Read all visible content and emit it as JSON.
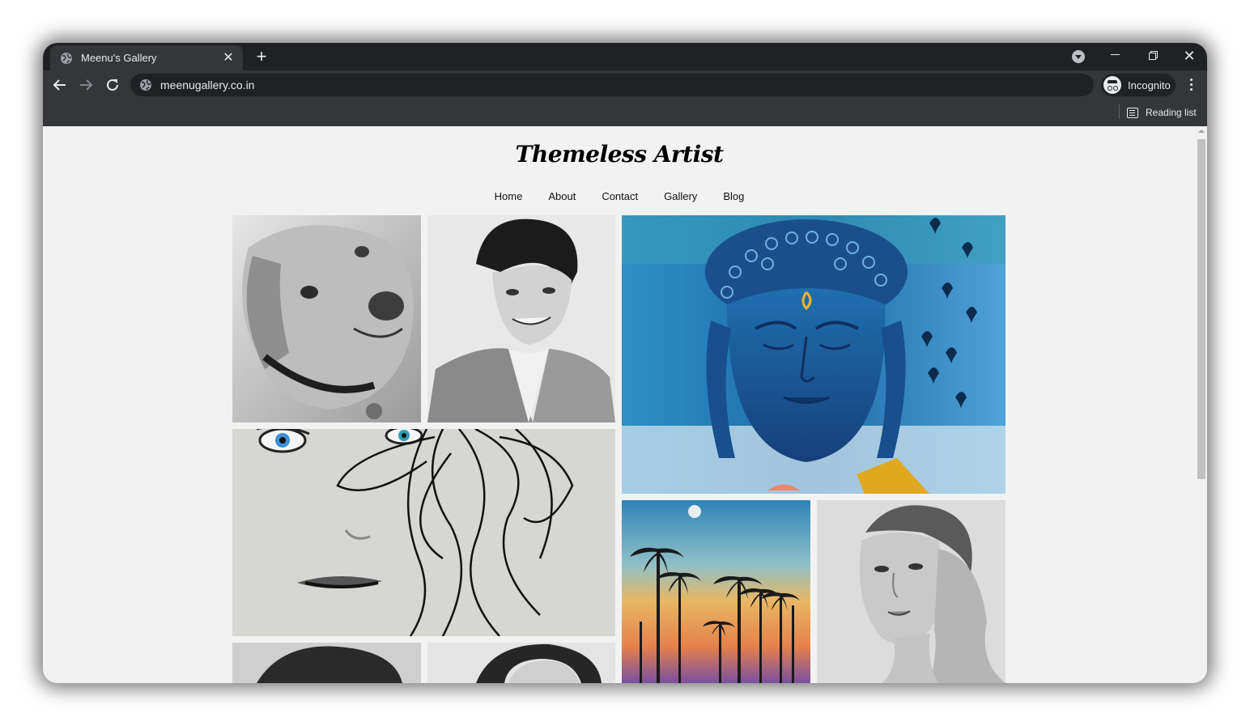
{
  "browser": {
    "tab_title": "Meenu's Gallery",
    "url": "meenugallery.co.in",
    "profile_label": "Incognito",
    "reading_list_label": "Reading list",
    "close_glyph": "✕",
    "new_tab_glyph": "+"
  },
  "site": {
    "title": "Themeless Artist",
    "nav": [
      "Home",
      "About",
      "Contact",
      "Gallery",
      "Blog"
    ]
  },
  "colors": {
    "chrome_dark": "#202124",
    "chrome_toolbar": "#35363a",
    "page_bg": "#f2f2f2",
    "buddha_blue": "#1f5f9e"
  },
  "gallery": [
    {
      "name": "dog-sketch"
    },
    {
      "name": "man-portrait-sketch"
    },
    {
      "name": "blue-buddha-painting"
    },
    {
      "name": "blue-eyed-face-sketch"
    },
    {
      "name": "palm-trees-sunset-painting"
    },
    {
      "name": "woman-portrait-sketch"
    },
    {
      "name": "girl-sketch"
    },
    {
      "name": "girl-sketch-2"
    }
  ]
}
